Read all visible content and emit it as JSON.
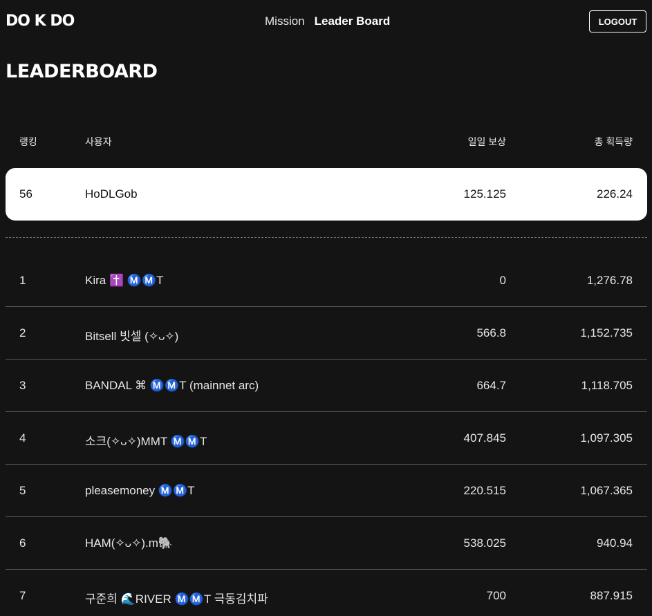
{
  "nav": {
    "logo": "DO K DO",
    "links": [
      "Mission",
      "Leader Board"
    ],
    "logout": "LOGOUT"
  },
  "page_title": "LEADERBOARD",
  "table_headers": {
    "rank": "랭킹",
    "user": "사용자",
    "daily": "일일 보상",
    "total": "총 획득량"
  },
  "my_row": {
    "rank": "56",
    "user": "HoDLGob",
    "daily": "125.125",
    "total": "226.24"
  },
  "rows": [
    {
      "rank": "1",
      "user": "Kira ✝️ Ⓜ️Ⓜ️T",
      "daily": "0",
      "total": "1,276.78"
    },
    {
      "rank": "2",
      "user": "Bitsell 빗셀 (✧ᴗ✧)",
      "daily": "566.8",
      "total": "1,152.735"
    },
    {
      "rank": "3",
      "user": "BANDAL ⌘ Ⓜ️Ⓜ️T (mainnet arc)",
      "daily": "664.7",
      "total": "1,118.705"
    },
    {
      "rank": "4",
      "user": "소크(✧ᴗ✧)MMT Ⓜ️Ⓜ️T",
      "daily": "407.845",
      "total": "1,097.305"
    },
    {
      "rank": "5",
      "user": "pleasemoney Ⓜ️Ⓜ️T",
      "daily": "220.515",
      "total": "1,067.365"
    },
    {
      "rank": "6",
      "user": "HAM(✧ᴗ✧).m🐘",
      "daily": "538.025",
      "total": "940.94"
    },
    {
      "rank": "7",
      "user": "구준희 🌊RIVER Ⓜ️Ⓜ️T 극동김치파",
      "daily": "700",
      "total": "887.915"
    }
  ]
}
